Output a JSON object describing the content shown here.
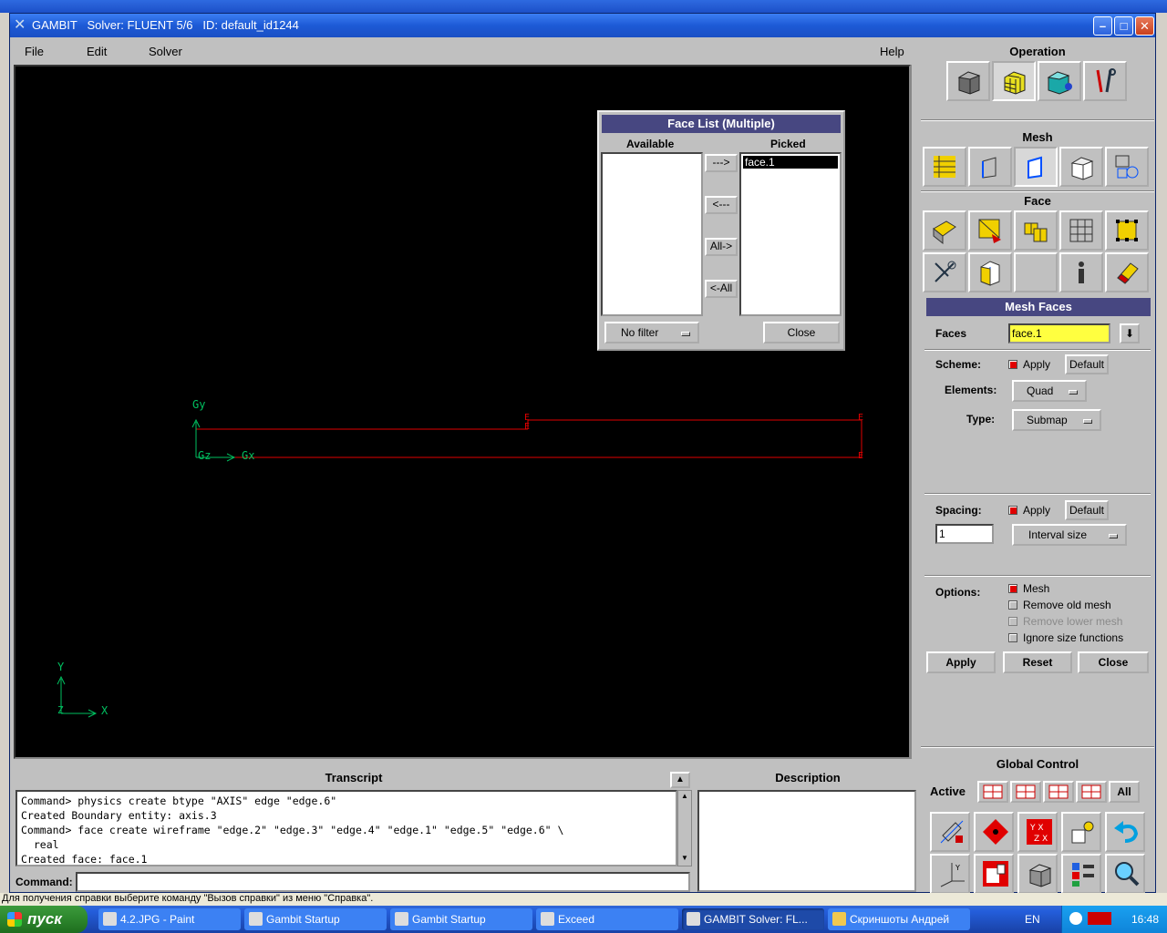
{
  "window": {
    "app_name": "GAMBIT",
    "title": "Solver: FLUENT 5/6   ID: default_id1244"
  },
  "menu": {
    "file": "File",
    "edit": "Edit",
    "solver": "Solver",
    "help": "Help"
  },
  "viewport": {
    "axis_labels": {
      "gy": "Gy",
      "gx": "Gx",
      "gz": "Gz",
      "y": "Y",
      "x": "X",
      "z": "Z"
    },
    "geometry_color": "#e00000",
    "axis_color": "#00c060"
  },
  "face_list": {
    "title": "Face List (Multiple)",
    "available_label": "Available",
    "picked_label": "Picked",
    "picked_items": [
      "face.1"
    ],
    "btn_add": "--->",
    "btn_remove": "<---",
    "btn_all_add": "All->",
    "btn_all_remove": "<-All",
    "filter": "No filter",
    "close": "Close"
  },
  "panel": {
    "operation": "Operation",
    "mesh": "Mesh",
    "face": "Face",
    "global_control": "Global Control",
    "active_label": "Active",
    "all_label": "All"
  },
  "mesh_faces": {
    "title": "Mesh Faces",
    "faces_label": "Faces",
    "faces_value": "face.1",
    "scheme_label": "Scheme:",
    "apply_label": "Apply",
    "default_label": "Default",
    "elements_label": "Elements:",
    "elements_value": "Quad",
    "type_label": "Type:",
    "type_value": "Submap",
    "spacing_label": "Spacing:",
    "spacing_value": "1",
    "spacing_mode": "Interval size",
    "options_label": "Options:",
    "opt_mesh": "Mesh",
    "opt_remove_old": "Remove old mesh",
    "opt_remove_lower": "Remove lower mesh",
    "opt_ignore_size": "Ignore size functions",
    "btn_apply": "Apply",
    "btn_reset": "Reset",
    "btn_close": "Close"
  },
  "transcript": {
    "title": "Transcript",
    "lines": [
      "Command> physics create btype \"AXIS\" edge \"edge.6\"",
      "Created Boundary entity: axis.3",
      "Command> face create wireframe \"edge.2\" \"edge.3\" \"edge.4\" \"edge.1\" \"edge.5\" \"edge.6\" \\",
      "  real",
      "Created face: face.1"
    ],
    "command_label": "Command:"
  },
  "description": {
    "title": "Description"
  },
  "statusbar": {
    "text": "Для получения справки выберите команду \"Вызов справки\" из меню \"Справка\"."
  },
  "taskbar": {
    "start": "пуск",
    "tasks": [
      "4.2.JPG - Paint",
      "Gambit Startup",
      "Gambit Startup",
      "Exceed",
      "GAMBIT    Solver: FL...",
      "Скриншоты Андрей"
    ],
    "lang": "EN",
    "clock": "16:48"
  }
}
